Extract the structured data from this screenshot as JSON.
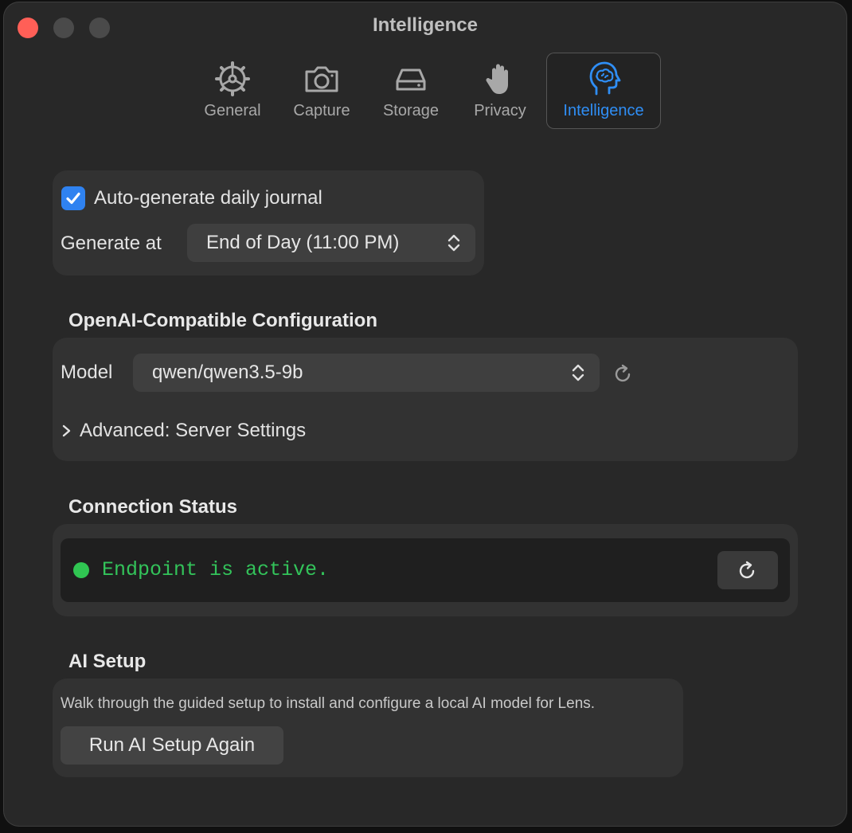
{
  "window": {
    "title": "Intelligence"
  },
  "tabs": [
    {
      "label": "General",
      "icon": "gear-icon"
    },
    {
      "label": "Capture",
      "icon": "camera-icon"
    },
    {
      "label": "Storage",
      "icon": "drive-icon"
    },
    {
      "label": "Privacy",
      "icon": "hand-icon"
    },
    {
      "label": "Intelligence",
      "icon": "brain-head-icon",
      "active": true
    }
  ],
  "journal": {
    "auto_generate_label": "Auto-generate daily journal",
    "auto_generate_checked": true,
    "generate_at_label": "Generate at",
    "generate_at_value": "End of Day (11:00 PM)"
  },
  "openai": {
    "section_title": "OpenAI-Compatible Configuration",
    "model_label": "Model",
    "model_value": "qwen/qwen3.5-9b",
    "advanced_label": "Advanced: Server Settings"
  },
  "connection": {
    "section_title": "Connection Status",
    "status_text": "Endpoint is active.",
    "status_color": "#30c552"
  },
  "ai_setup": {
    "section_title": "AI Setup",
    "description": "Walk through the guided setup to install and configure a local AI model for Lens.",
    "button_label": "Run AI Setup Again"
  },
  "colors": {
    "accent": "#2f82f0",
    "window_bg": "#282828",
    "group_bg": "#323232"
  }
}
